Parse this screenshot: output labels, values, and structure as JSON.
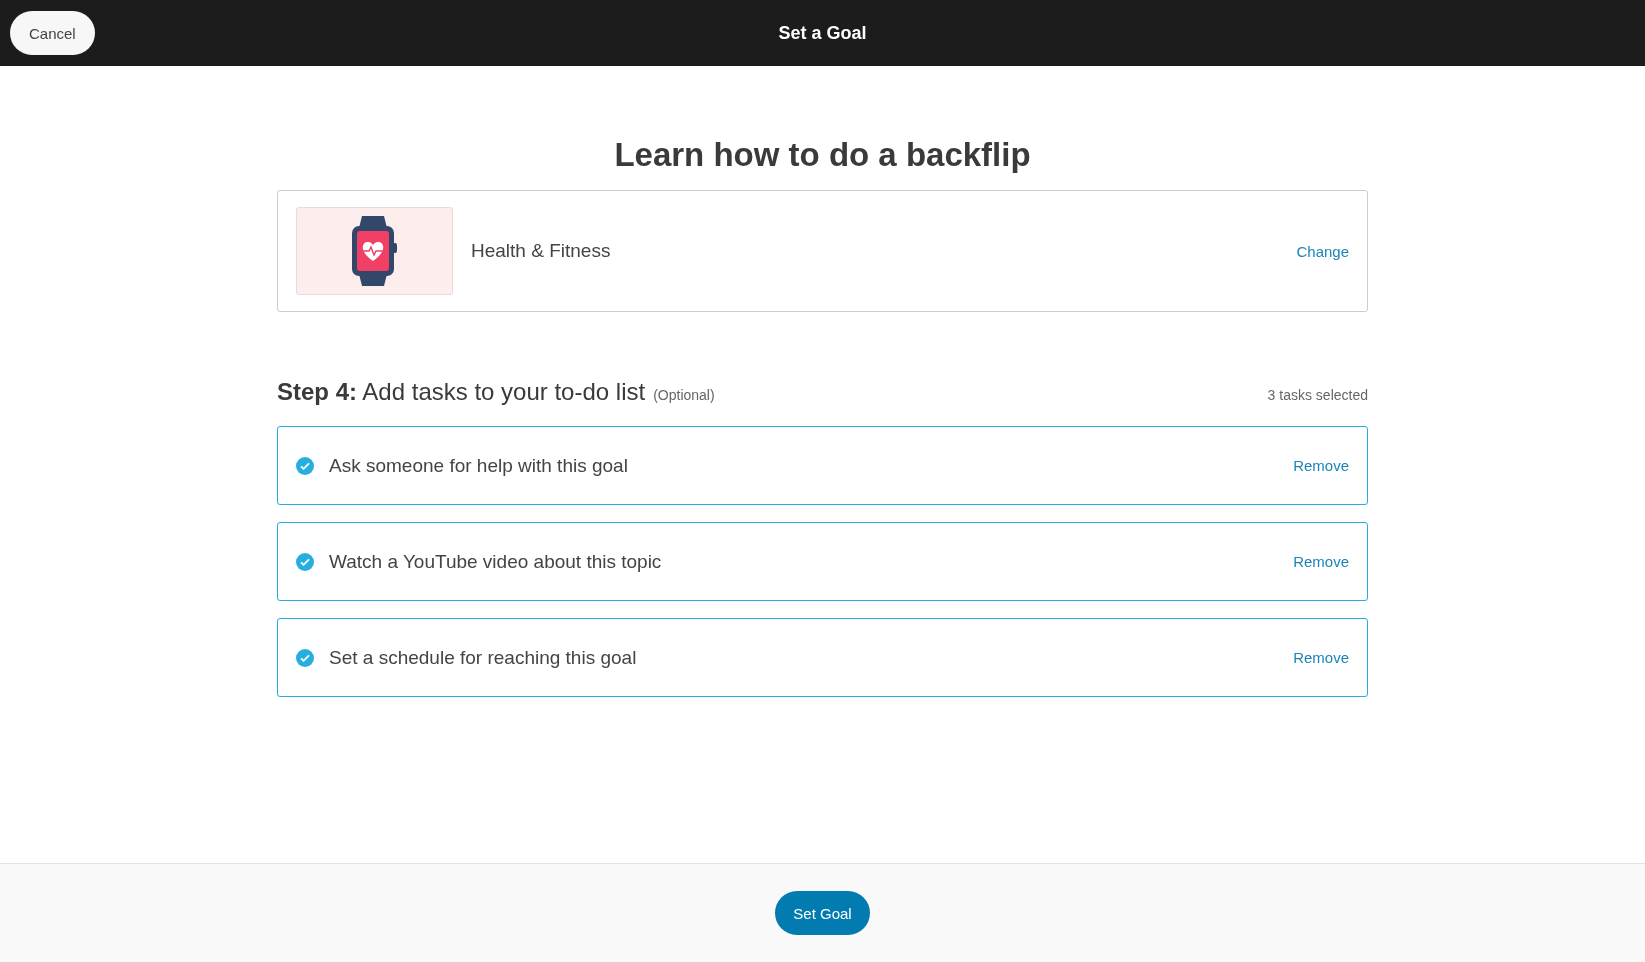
{
  "header": {
    "cancel": "Cancel",
    "title": "Set a Goal"
  },
  "goal_title": "Learn how to do a backflip",
  "category": {
    "name": "Health & Fitness",
    "action": "Change"
  },
  "step": {
    "heading": "**Step 4:** Add tasks to your to-do list",
    "note": "(Optional)",
    "count": "3 tasks selected"
  },
  "tasks": [
    {
      "label": "Ask someone for help with this goal",
      "checked": true,
      "action": "Remove"
    },
    {
      "label": "Watch a YouTube video about this topic",
      "checked": true,
      "action": "Remove"
    },
    {
      "label": "Set a schedule for reaching this goal",
      "checked": true,
      "action": "Remove"
    }
  ],
  "footer": {
    "button": "Set Goal"
  }
}
